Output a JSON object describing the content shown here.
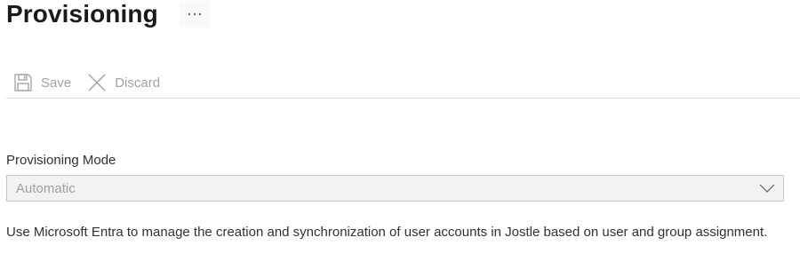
{
  "header": {
    "title": "Provisioning",
    "more_icon": "more-ellipsis-icon"
  },
  "toolbar": {
    "save_label": "Save",
    "save_icon": "save-floppy-icon",
    "discard_label": "Discard",
    "discard_icon": "close-x-icon",
    "disabled_color": "#a19f9d"
  },
  "form": {
    "mode_label": "Provisioning Mode",
    "mode_value": "Automatic",
    "mode_chevron_icon": "chevron-down-icon",
    "description": "Use Microsoft Entra to manage the creation and synchronization of user accounts in Jostle based on user and group assignment."
  }
}
